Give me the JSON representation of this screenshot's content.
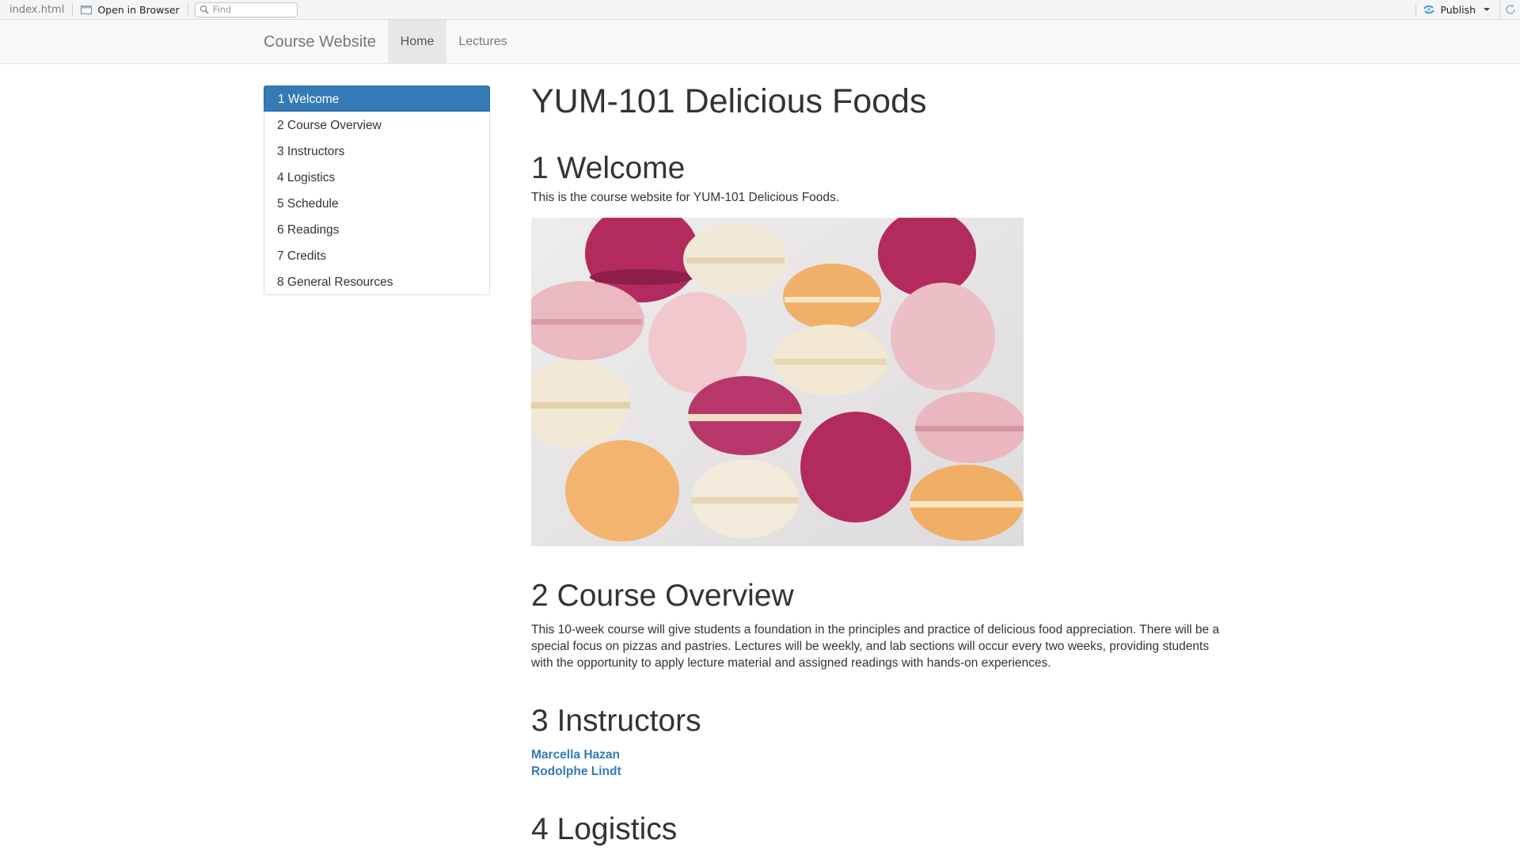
{
  "viewer": {
    "filename": "index.html",
    "open_in_browser": "Open in Browser",
    "find_placeholder": "Find",
    "publish": "Publish"
  },
  "navbar": {
    "brand": "Course Website",
    "items": [
      {
        "label": "Home",
        "active": true
      },
      {
        "label": "Lectures",
        "active": false
      }
    ]
  },
  "toc": {
    "items": [
      {
        "label": "1 Welcome",
        "active": true
      },
      {
        "label": "2 Course Overview"
      },
      {
        "label": "3 Instructors"
      },
      {
        "label": "4 Logistics"
      },
      {
        "label": "5 Schedule"
      },
      {
        "label": "6 Readings"
      },
      {
        "label": "7 Credits"
      },
      {
        "label": "8 General Resources"
      }
    ]
  },
  "main": {
    "title": "YUM-101 Delicious Foods",
    "welcome": {
      "heading": "1 Welcome",
      "text": "This is the course website for YUM-101 Delicious Foods."
    },
    "overview": {
      "heading": "2 Course Overview",
      "text": "This 10-week course will give students a foundation in the principles and practice of delicious food appreciation. There will be a special focus on pizzas and pastries. Lectures will be weekly, and lab sections will occur every two weeks, providing students with the opportunity to apply lecture material and assigned readings with hands-on experiences."
    },
    "instructors": {
      "heading": "3 Instructors",
      "names": [
        "Marcella Hazan",
        "Rodolphe Lindt"
      ]
    },
    "logistics": {
      "heading": "4 Logistics"
    }
  },
  "colors": {
    "accent": "#337ab7",
    "photo_background": "#e8e6e6",
    "macaron_raspberry": "#b32b5e",
    "macaron_cream": "#f1e9d8",
    "macaron_orange": "#f0b06a",
    "macaron_pink": "#eab9c2"
  }
}
